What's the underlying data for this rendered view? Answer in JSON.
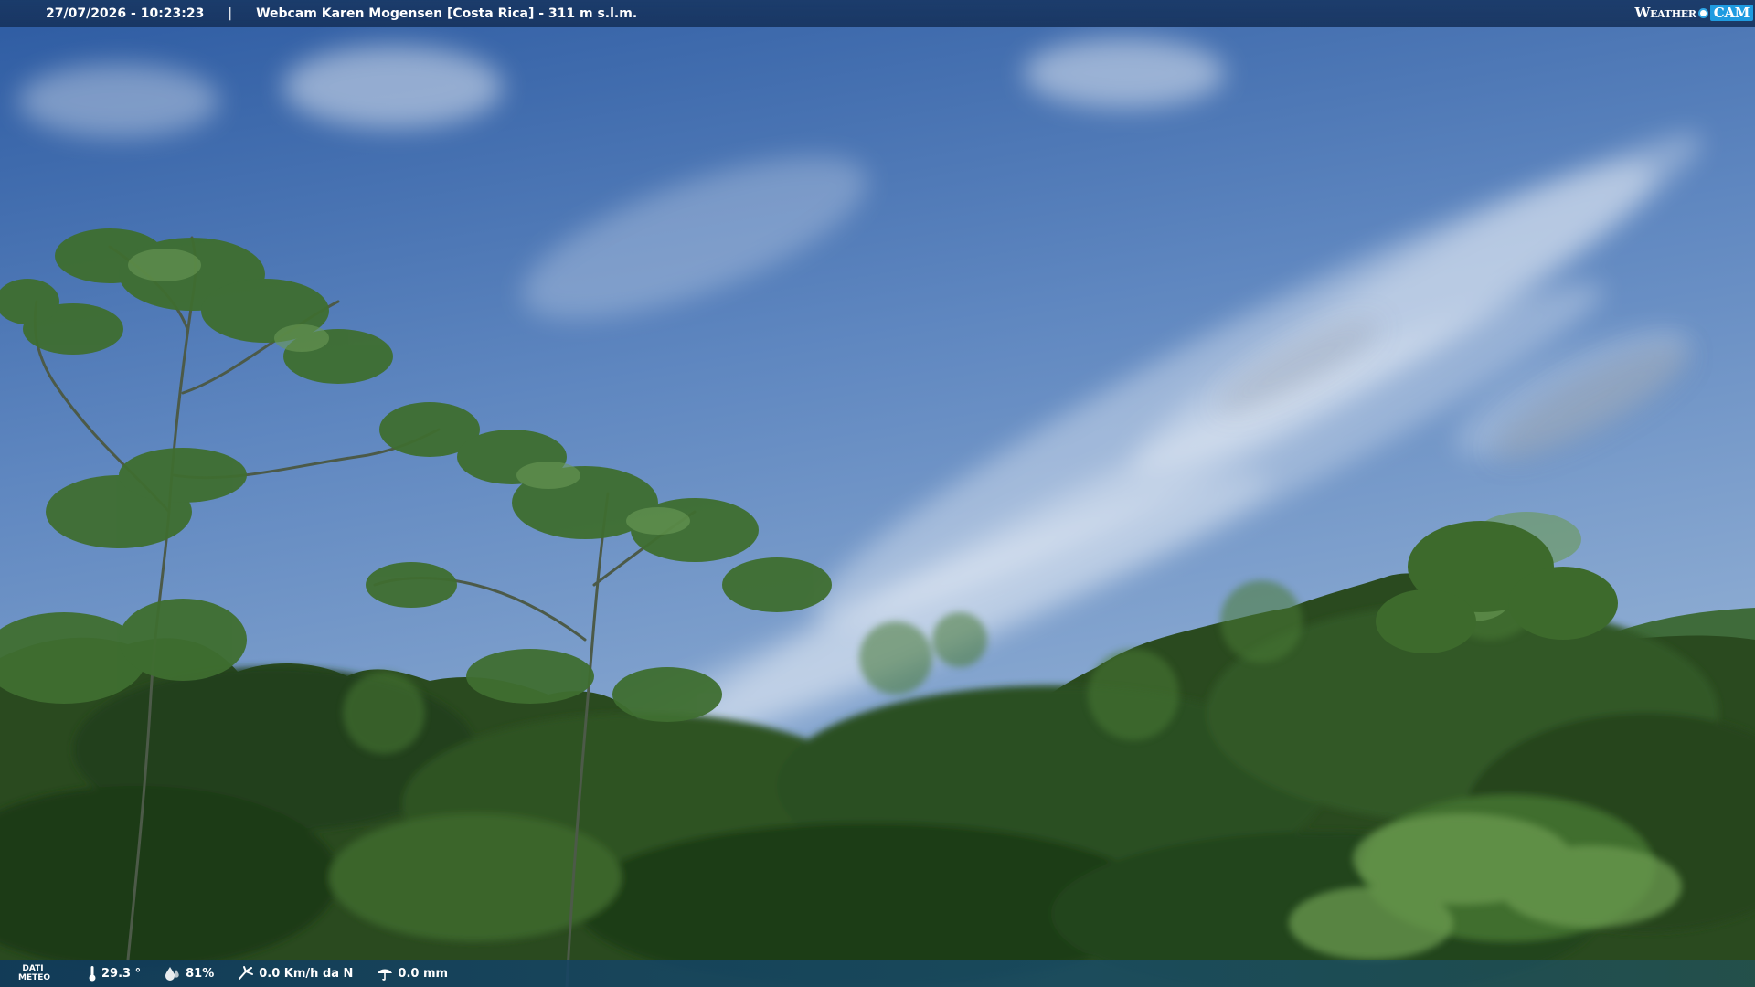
{
  "header": {
    "datetime": "27/07/2026 - 10:23:23",
    "separator": "|",
    "webcam_title": "Webcam Karen Mogensen [Costa Rica] - 311 m s.l.m.",
    "brand_weather": "Weather",
    "brand_cam": "CAM"
  },
  "footer": {
    "dati_line1": "DATI",
    "dati_line2": "METEO",
    "temperature": "29.3 °",
    "humidity": "81%",
    "wind": "0.0 Km/h da N",
    "rain": "0.0 mm",
    "icons": [
      "thermometer-icon",
      "humidity-drop-icon",
      "wind-icon",
      "rain-icon"
    ]
  },
  "colors": {
    "sky_top": "#2f5fa6",
    "sky_bottom": "#7ea4cf",
    "foliage_dark": "#1f3a16",
    "foliage_mid": "#3f6a2a",
    "brand_accent": "#1f9be0"
  }
}
